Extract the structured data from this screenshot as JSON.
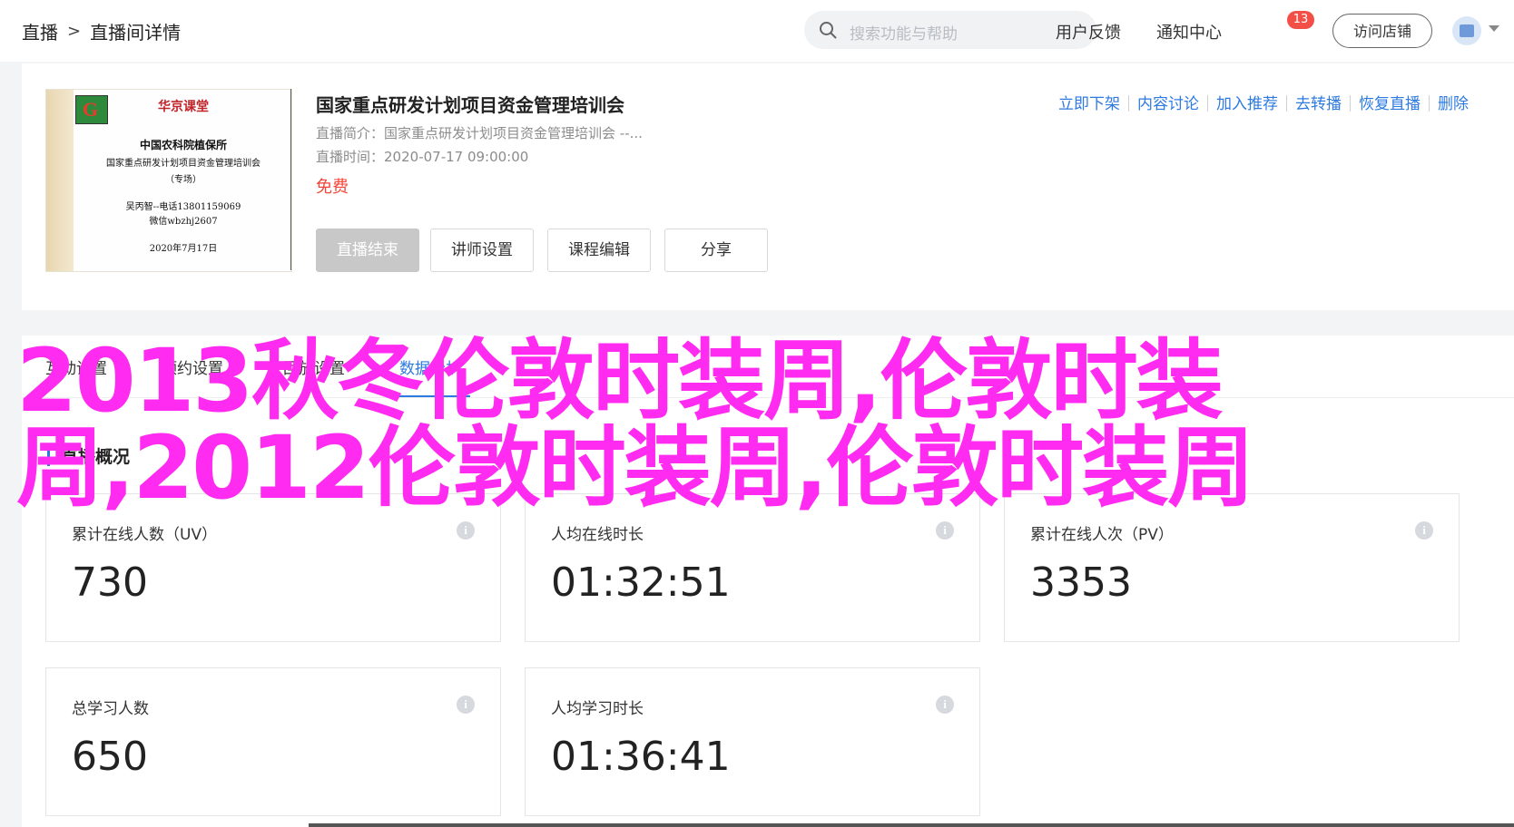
{
  "header": {
    "breadcrumb": [
      "直播",
      "直播间详情"
    ],
    "breadcrumb_sep": ">",
    "search_placeholder": "搜索功能与帮助",
    "feedback": "用户反馈",
    "notifications": "通知中心",
    "notification_count": "13",
    "visit_store": "访问店铺"
  },
  "course": {
    "poster": {
      "org": "华京课堂",
      "line1": "中国农科院植保所",
      "line2": "国家重点研发计划项目资金管理培训会",
      "line3": "（专场）",
      "contact1": "吴丙智--电话13801159069",
      "contact2": "微信wbzhj2607",
      "date": "2020年7月17日"
    },
    "title": "国家重点研发计划项目资金管理培训会",
    "intro_label": "直播简介：",
    "intro_value": "国家重点研发计划项目资金管理培训会 --...",
    "time_label": "直播时间：",
    "time_value": "2020-07-17 09:00:00",
    "price": "免费",
    "buttons": [
      "直播结束",
      "讲师设置",
      "课程编辑",
      "分享"
    ],
    "actions": [
      "立即下架",
      "内容讨论",
      "加入推荐",
      "去转播",
      "恢复直播",
      "删除"
    ]
  },
  "tabs": {
    "items": [
      "互动设置",
      "预约设置",
      "回放设置",
      "数据分析"
    ],
    "active_index": 3
  },
  "overview": {
    "title": "直播概况",
    "stats": [
      {
        "label": "累计在线人数（UV）",
        "value": "730"
      },
      {
        "label": "人均在线时长",
        "value": "01:32:51"
      },
      {
        "label": "累计在线人次（PV）",
        "value": "3353"
      },
      {
        "label": "总学习人数",
        "value": "650"
      },
      {
        "label": "人均学习时长",
        "value": "01:36:41"
      }
    ]
  },
  "overlay": {
    "text": "2013秋冬伦敦时装周,伦敦时装周,2012伦敦时装周,伦敦时装周",
    "color": "#ff2bf0"
  },
  "colors": {
    "accent": "#2d7ae1",
    "price": "#f04637",
    "badge": "#f25046"
  }
}
